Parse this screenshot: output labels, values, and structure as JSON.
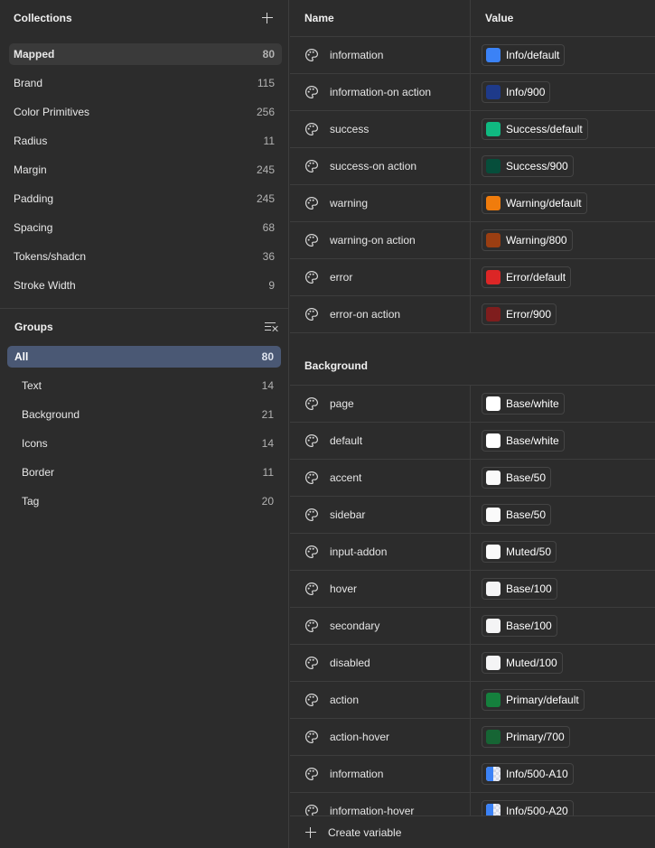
{
  "collections": {
    "title": "Collections",
    "items": [
      {
        "label": "Mapped",
        "count": "80",
        "active": true
      },
      {
        "label": "Brand",
        "count": "115"
      },
      {
        "label": "Color Primitives",
        "count": "256"
      },
      {
        "label": "Radius",
        "count": "11"
      },
      {
        "label": "Margin",
        "count": "245"
      },
      {
        "label": "Padding",
        "count": "245"
      },
      {
        "label": "Spacing",
        "count": "68"
      },
      {
        "label": "Tokens/shadcn",
        "count": "36"
      },
      {
        "label": "Stroke Width",
        "count": "9"
      }
    ]
  },
  "groups": {
    "title": "Groups",
    "items": [
      {
        "label": "All",
        "count": "80",
        "active": true
      },
      {
        "label": "Text",
        "count": "14"
      },
      {
        "label": "Background",
        "count": "21"
      },
      {
        "label": "Icons",
        "count": "14"
      },
      {
        "label": "Border",
        "count": "11"
      },
      {
        "label": "Tag",
        "count": "20"
      }
    ]
  },
  "table": {
    "col_name": "Name",
    "col_value": "Value",
    "rows_top": [
      {
        "name": "information",
        "value": "Info/default",
        "color": "#3b82f6"
      },
      {
        "name": "information-on action",
        "value": "Info/900",
        "color": "#1e3a8a"
      },
      {
        "name": "success",
        "value": "Success/default",
        "color": "#10b981"
      },
      {
        "name": "success-on action",
        "value": "Success/900",
        "color": "#064e3b"
      },
      {
        "name": "warning",
        "value": "Warning/default",
        "color": "#f07c0c"
      },
      {
        "name": "warning-on action",
        "value": "Warning/800",
        "color": "#9a3e12"
      },
      {
        "name": "error",
        "value": "Error/default",
        "color": "#dc2626"
      },
      {
        "name": "error-on action",
        "value": "Error/900",
        "color": "#7f1d1d"
      }
    ],
    "group_background": "Background",
    "rows_background": [
      {
        "name": "page",
        "value": "Base/white",
        "color": "#ffffff"
      },
      {
        "name": "default",
        "value": "Base/white",
        "color": "#ffffff"
      },
      {
        "name": "accent",
        "value": "Base/50",
        "color": "#fafafa"
      },
      {
        "name": "sidebar",
        "value": "Base/50",
        "color": "#fafafa"
      },
      {
        "name": "input-addon",
        "value": "Muted/50",
        "color": "#fafafa"
      },
      {
        "name": "hover",
        "value": "Base/100",
        "color": "#f4f4f5"
      },
      {
        "name": "secondary",
        "value": "Base/100",
        "color": "#f4f4f5"
      },
      {
        "name": "disabled",
        "value": "Muted/100",
        "color": "#f4f4f5"
      },
      {
        "name": "action",
        "value": "Primary/default",
        "color": "#15803d"
      },
      {
        "name": "action-hover",
        "value": "Primary/700",
        "color": "#166534"
      },
      {
        "name": "information",
        "value": "Info/500-A10",
        "color": "#3b82f6",
        "alpha": true
      },
      {
        "name": "information-hover",
        "value": "Info/500-A20",
        "color": "#3b82f6",
        "alpha": true
      }
    ]
  },
  "footer": {
    "create_label": "Create variable"
  }
}
